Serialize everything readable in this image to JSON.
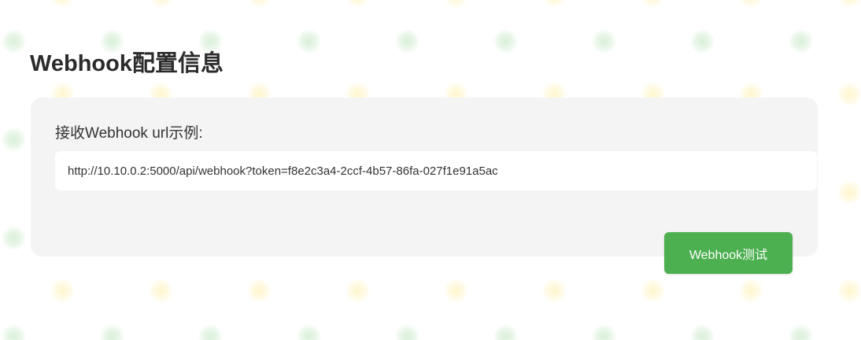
{
  "page": {
    "title": "Webhook配置信息"
  },
  "webhook": {
    "label": "接收Webhook url示例:",
    "url_value": "http://10.10.0.2:5000/api/webhook?token=f8e2c3a4-2ccf-4b57-86fa-027f1e91a5ac",
    "test_button_label": "Webhook测试"
  },
  "colors": {
    "button_background": "#4caf50",
    "panel_background": "#f4f4f4",
    "title_text": "#2b2b2b"
  }
}
